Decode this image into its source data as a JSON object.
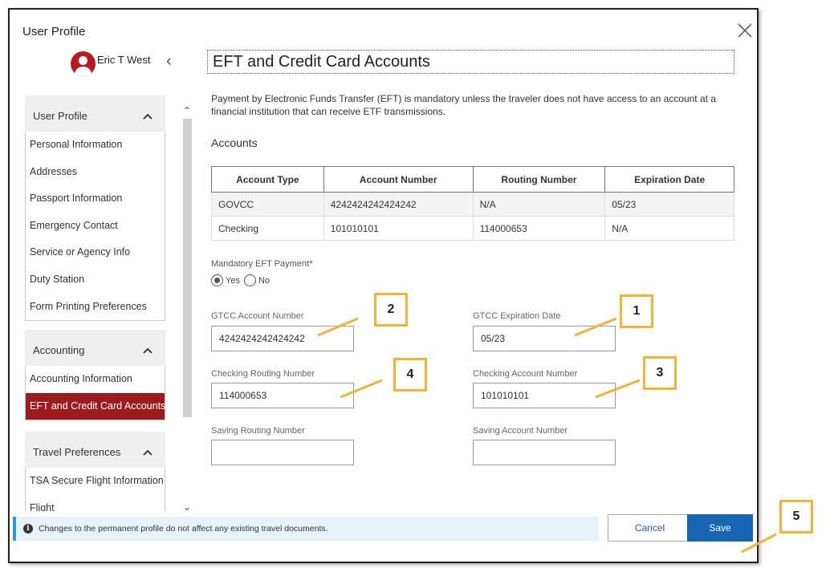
{
  "dialog": {
    "title": "User Profile"
  },
  "user": {
    "name": "Eric T West"
  },
  "icons": {
    "close": "close-icon",
    "avatar": "user-avatar-icon",
    "collapse": "chevron-left-icon",
    "info": "info-icon"
  },
  "colors": {
    "brand_red": "#9b1b1f",
    "primary_blue": "#1766b4",
    "callout_border": "#f5b335",
    "info_bg": "#e6f4fa"
  },
  "sidebar": {
    "groups": [
      {
        "label": "User Profile",
        "items": [
          "Personal Information",
          "Addresses",
          "Passport Information",
          "Emergency Contact",
          "Service or Agency Info",
          "Duty Station",
          "Form Printing Preferences"
        ]
      },
      {
        "label": "Accounting",
        "items": [
          "Accounting Information",
          "EFT and Credit Card Accounts"
        ],
        "active_item": "EFT and Credit Card Accounts"
      },
      {
        "label": "Travel Preferences",
        "items": [
          "TSA Secure Flight Information",
          "Flight"
        ]
      }
    ]
  },
  "main": {
    "heading": "EFT and Credit Card Accounts",
    "intro": "Payment by Electronic Funds Transfer (EFT) is mandatory unless the traveler does not have access to an account at a financial institution that can receive ETF transmissions.",
    "accounts_heading": "Accounts",
    "table": {
      "headers": [
        "Account Type",
        "Account Number",
        "Routing Number",
        "Expiration Date"
      ],
      "rows": [
        [
          "GOVCC",
          "4242424242424242",
          "N/A",
          "05/23"
        ],
        [
          "Checking",
          "101010101",
          "114000653",
          "N/A"
        ]
      ]
    },
    "mandatory_eft": {
      "label": "Mandatory EFT Payment",
      "required_mark": "*",
      "options": [
        "Yes",
        "No"
      ],
      "selected": "Yes"
    },
    "fields": {
      "gtcc_account_number": {
        "label": "GTCC Account Number",
        "value": "4242424242424242"
      },
      "gtcc_expiration_date": {
        "label": "GTCC Expiration Date",
        "value": "05/23"
      },
      "checking_routing_number": {
        "label": "Checking Routing Number",
        "value": "114000653"
      },
      "checking_account_number": {
        "label": "Checking Account Number",
        "value": "101010101"
      },
      "saving_routing_number": {
        "label": "Saving Routing Number",
        "value": ""
      },
      "saving_account_number": {
        "label": "Saving Account Number",
        "value": ""
      }
    }
  },
  "callouts": [
    "1",
    "2",
    "3",
    "4",
    "5"
  ],
  "footer": {
    "note": "Changes to the permanent profile do not affect any existing travel documents.",
    "cancel_label": "Cancel",
    "save_label": "Save"
  }
}
